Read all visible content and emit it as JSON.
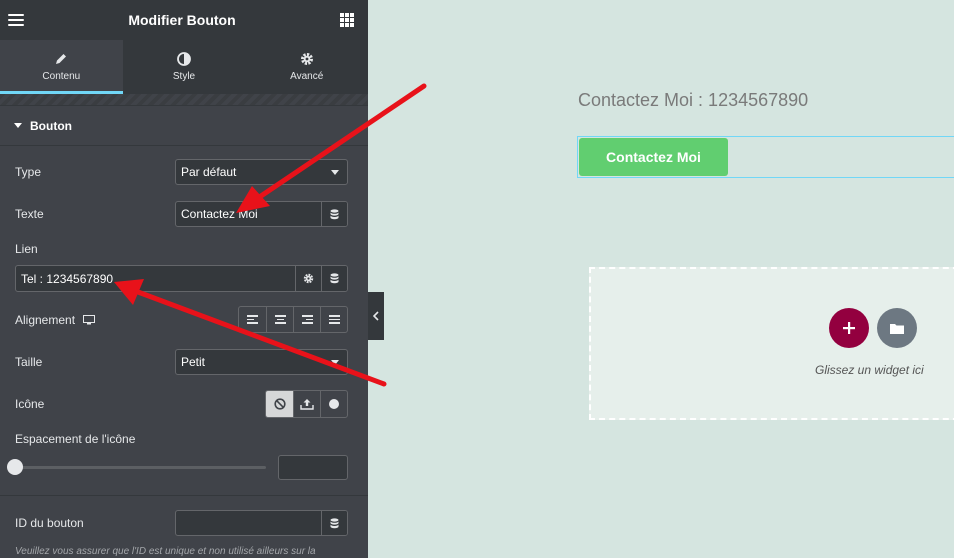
{
  "header": {
    "title": "Modifier Bouton"
  },
  "tabs": [
    {
      "label": "Contenu",
      "icon": "pencil-icon",
      "active": true
    },
    {
      "label": "Style",
      "icon": "contrast-icon",
      "active": false
    },
    {
      "label": "Avancé",
      "icon": "gear-icon",
      "active": false
    }
  ],
  "section": {
    "title": "Bouton"
  },
  "controls": {
    "type": {
      "label": "Type",
      "value": "Par défaut"
    },
    "texte": {
      "label": "Texte",
      "value": "Contactez Moi"
    },
    "lien": {
      "label": "Lien",
      "value": "Tel : 1234567890"
    },
    "alignement": {
      "label": "Alignement"
    },
    "taille": {
      "label": "Taille",
      "value": "Petit"
    },
    "icone": {
      "label": "Icône"
    },
    "espacement": {
      "label": "Espacement de l'icône",
      "value": ""
    },
    "id_bouton": {
      "label": "ID du bouton",
      "value": ""
    }
  },
  "note": "Veuillez vous assurer que l'ID est unique et non utilisé ailleurs sur la",
  "canvas": {
    "heading": "Contactez Moi : 1234567890",
    "button_label": "Contactez Moi",
    "drop_text": "Glissez un widget ici"
  },
  "colors": {
    "panel": "#404349",
    "accent_tab": "#71d7f7",
    "canvas_button": "#61ce70",
    "add_button": "#93003f",
    "annotation_arrow": "#e8121a"
  }
}
